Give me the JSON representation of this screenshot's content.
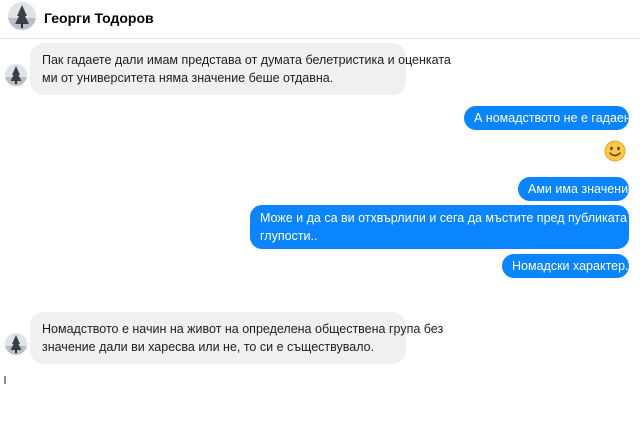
{
  "contact": {
    "name": "Георги Тодоров"
  },
  "messages": [
    {
      "direction": "incoming",
      "lines": [
        "Пак гадаете дали имам представа от думата белетристика и оценката",
        "ми от университета няма значение беше отдавна."
      ]
    },
    {
      "direction": "outgoing",
      "lines": [
        "А номадството не е гадаене ?"
      ]
    },
    {
      "direction": "outgoing",
      "type": "emoji",
      "icon": "smiling-face-emoji"
    },
    {
      "direction": "outgoing",
      "lines": [
        "Ами има значение"
      ]
    },
    {
      "direction": "outgoing",
      "lines": [
        "Може и да са ви отхвърлили и сега да мъстите пред публиката с",
        "глупости.."
      ]
    },
    {
      "direction": "outgoing",
      "lines": [
        "Номадски характер....."
      ]
    },
    {
      "direction": "incoming",
      "lines": [
        "Номадството е начин на живот на определена обществена група без",
        "значение дали ви харесва или не, то си е съществувало."
      ]
    }
  ],
  "colors": {
    "outgoing_bubble": "#0a84ff",
    "incoming_bubble": "#f0f0f1"
  }
}
